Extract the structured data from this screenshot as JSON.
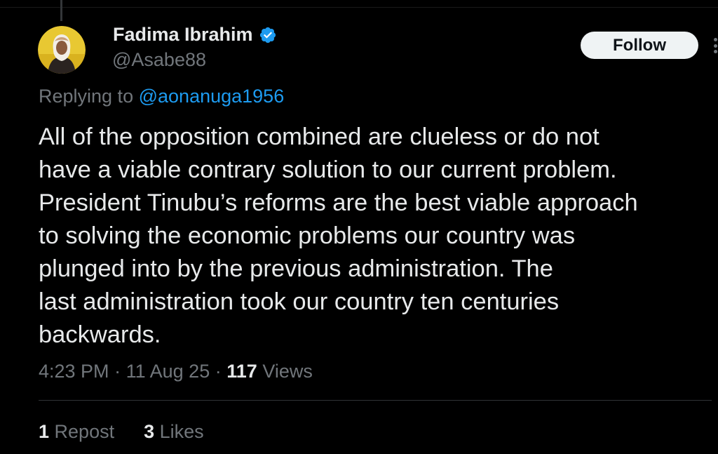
{
  "tweet": {
    "author": {
      "display_name": "Fadima Ibrahim",
      "handle": "@Asabe88",
      "verified_icon": "verified-badge-icon",
      "avatar_icon": "avatar"
    },
    "follow_label": "Follow",
    "replying_prefix": "Replying to",
    "replying_to": "@aonanuga1956",
    "text_lines": [
      "All of the opposition combined are clueless or do not",
      "have a viable contrary solution to our current problem.",
      "President Tinubu’s reforms are the best viable approach",
      "to solving the economic problems our country was",
      "plunged into by the previous administration. The",
      "last administration took our country ten centuries",
      "backwards."
    ],
    "time": "4:23 PM",
    "separator": "·",
    "date": "11 Aug 25",
    "views_count": "117",
    "views_label": "Views",
    "reposts_count": "1",
    "reposts_label": "Repost",
    "likes_count": "3",
    "likes_label": "Likes"
  },
  "colors": {
    "background": "#000000",
    "text_primary": "#e7e9ea",
    "text_secondary": "#71767b",
    "link": "#1d9bf0",
    "button_bg": "#eff3f4"
  }
}
